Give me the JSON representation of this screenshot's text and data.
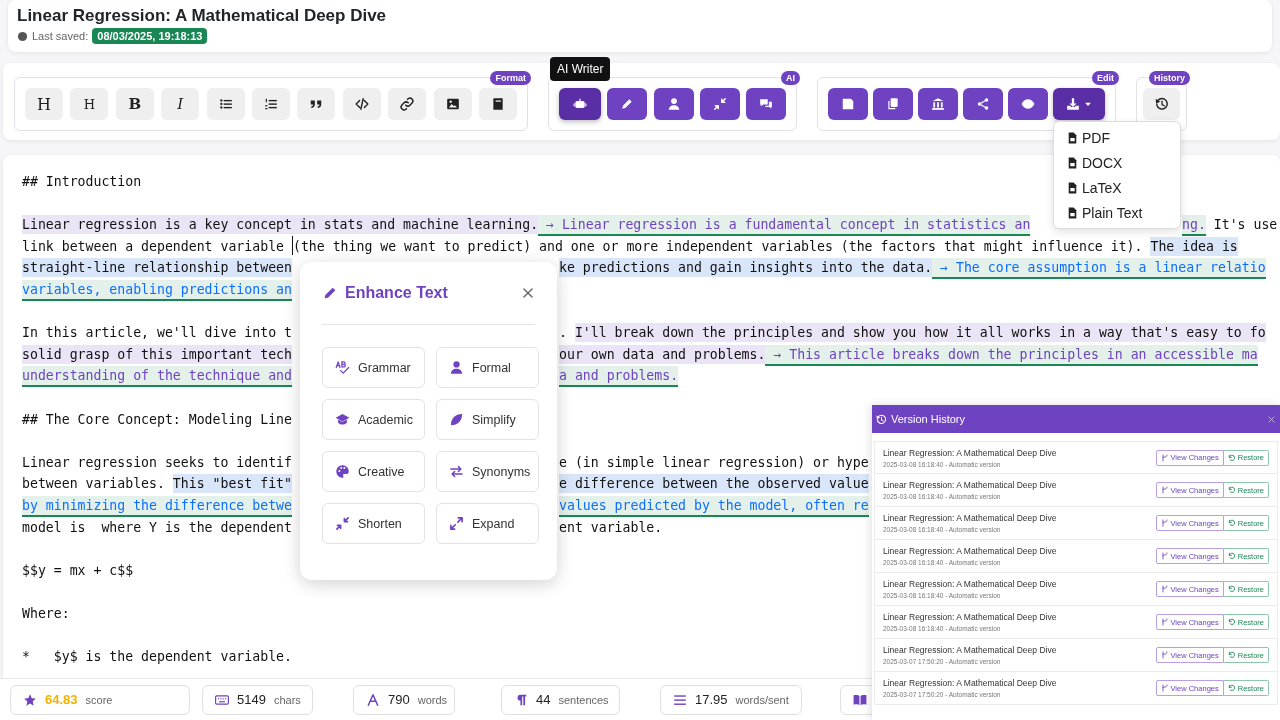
{
  "document": {
    "title": "Linear Regression: A Mathematical Deep Dive",
    "saved_label": "Last saved:",
    "saved_time": "08/03/2025, 19:18:13"
  },
  "toolbar": {
    "format": {
      "badge": "Format",
      "text_buttons": [
        "H",
        "H",
        "B",
        "I"
      ]
    },
    "ai": {
      "badge": "AI",
      "tooltip": "AI Writer",
      "buttons": [
        {
          "selected": true
        },
        {
          "selected": false
        },
        {
          "selected": false
        },
        {
          "selected": false
        },
        {
          "selected": false
        }
      ]
    },
    "edit": {
      "badge": "Edit",
      "download_menu": {
        "open": true,
        "items": [
          "PDF",
          "DOCX",
          "LaTeX",
          "Plain Text"
        ]
      }
    },
    "history": {
      "badge": "History"
    }
  },
  "editor": {
    "paragraphs": [
      {
        "lines": [
          {
            "segments": [
              {
                "kind": "plain",
                "text": "## Introduction"
              }
            ]
          }
        ]
      },
      {
        "lines": [
          {
            "segments": [
              {
                "kind": "original",
                "text": "Linear regression is a key concept in stats and machine learning."
              },
              {
                "kind": "rewrite",
                "text": " → Linear regression is a fundamental concept in statistics an"
              }
            ],
            "after_menu": [
              {
                "kind": "rewrite",
                "text": "ng."
              },
              {
                "kind": "plain",
                "text": " It's use"
              }
            ]
          },
          {
            "segments": [
              {
                "kind": "plain",
                "text": "link between a dependent variable "
              },
              {
                "kind": "plain",
                "cursor": true,
                "text": "(the thing we want to predict) and one or more independent variables (the factors that might influence it). "
              },
              {
                "kind": "selected",
                "text": "The idea is"
              }
            ]
          },
          {
            "segments": [
              {
                "kind": "selected",
                "text": "straight-line relationship between"
              }
            ],
            "after_popup": [
              {
                "kind": "selected",
                "text": "ke predictions and gain insights into the data."
              },
              {
                "kind": "selected-rewrite",
                "text": " → The core assumption is a linear relatio"
              }
            ]
          },
          {
            "segments": [
              {
                "kind": "selected-rewrite",
                "text": "variables, enabling predictions an"
              }
            ]
          }
        ]
      },
      {
        "lines": [
          {
            "segments": [
              {
                "kind": "plain",
                "text": "In this article, we'll dive into t"
              }
            ],
            "after_popup": [
              {
                "kind": "plain",
                "text": ". "
              },
              {
                "kind": "original",
                "text": "I'll break down the principles and show you how it all works in a way that's easy to fo"
              }
            ]
          },
          {
            "segments": [
              {
                "kind": "original",
                "text": "solid grasp of this important tech"
              }
            ],
            "after_popup": [
              {
                "kind": "original",
                "text": "our own data and problems."
              },
              {
                "kind": "rewrite",
                "text": " → This article breaks down the principles in an accessible ma"
              }
            ]
          },
          {
            "segments": [
              {
                "kind": "rewrite",
                "text": "understanding of the technique and"
              }
            ],
            "after_popup": [
              {
                "kind": "rewrite",
                "text": "a and problems."
              }
            ]
          }
        ]
      },
      {
        "lines": [
          {
            "segments": [
              {
                "kind": "plain",
                "text": "## The Core Concept: Modeling Line"
              }
            ]
          }
        ]
      },
      {
        "lines": [
          {
            "segments": [
              {
                "kind": "plain",
                "text": "Linear regression seeks to identif"
              }
            ],
            "after_popup": [
              {
                "kind": "plain",
                "text": "e (in simple linear regression) or hype"
              }
            ]
          },
          {
            "segments": [
              {
                "kind": "plain",
                "text": "between variables. "
              },
              {
                "kind": "selected",
                "text": "This \"best fit\""
              }
            ],
            "after_popup": [
              {
                "kind": "selected",
                "text": "e difference between the observed value"
              }
            ]
          },
          {
            "segments": [
              {
                "kind": "selected-rewrite",
                "text": "by minimizing the difference betwe"
              }
            ],
            "after_popup": [
              {
                "kind": "selected-rewrite",
                "text": "values predicted by the model, often re"
              }
            ]
          },
          {
            "segments": [
              {
                "kind": "plain",
                "text": "model is  where Y is the dependent"
              }
            ],
            "after_popup": [
              {
                "kind": "plain",
                "text": "ent variable."
              }
            ]
          }
        ]
      },
      {
        "lines": [
          {
            "segments": [
              {
                "kind": "plain",
                "text": "$$y = mx + c$$"
              }
            ]
          }
        ]
      },
      {
        "lines": [
          {
            "segments": [
              {
                "kind": "plain",
                "text": "Where:"
              }
            ]
          }
        ]
      },
      {
        "lines": [
          {
            "segments": [
              {
                "kind": "plain",
                "text": "*   $y$ is the dependent variable."
              }
            ]
          }
        ]
      }
    ]
  },
  "enhance": {
    "title": "Enhance Text",
    "options": [
      {
        "kind": "grammar",
        "label": "Grammar"
      },
      {
        "kind": "formal",
        "label": "Formal"
      },
      {
        "kind": "academic",
        "label": "Academic"
      },
      {
        "kind": "simplify",
        "label": "Simplify"
      },
      {
        "kind": "creative",
        "label": "Creative"
      },
      {
        "kind": "synonyms",
        "label": "Synonyms"
      },
      {
        "kind": "shorten",
        "label": "Shorten"
      },
      {
        "kind": "expand",
        "label": "Expand"
      }
    ]
  },
  "stats": [
    {
      "kind": "score",
      "value": "64.83",
      "unit": "score"
    },
    {
      "kind": "chars",
      "value": "5149",
      "unit": "chars"
    },
    {
      "kind": "words",
      "value": "790",
      "unit": "words"
    },
    {
      "kind": "sentences",
      "value": "44",
      "unit": "sentences"
    },
    {
      "kind": "average",
      "value": "17.95",
      "unit": "words/sent"
    },
    {
      "kind": "reading"
    }
  ],
  "version_history": {
    "title": "Version History",
    "versions": [
      {
        "title": "Linear Regression: A Mathematical Deep Dive",
        "meta": "2025-03-08 16:18:40 - Automatic version",
        "view": "View Changes",
        "restore": "Restore"
      },
      {
        "title": "Linear Regression: A Mathematical Deep Dive",
        "meta": "2025-03-08 16:18:40 - Automatic version",
        "view": "View Changes",
        "restore": "Restore"
      },
      {
        "title": "Linear Regression: A Mathematical Deep Dive",
        "meta": "2025-03-08 16:18:40 - Automatic version",
        "view": "View Changes",
        "restore": "Restore"
      },
      {
        "title": "Linear Regression: A Mathematical Deep Dive",
        "meta": "2025-03-08 16:18:40 - Automatic version",
        "view": "View Changes",
        "restore": "Restore"
      },
      {
        "title": "Linear Regression: A Mathematical Deep Dive",
        "meta": "2025-03-08 16:18:40 - Automatic version",
        "view": "View Changes",
        "restore": "Restore"
      },
      {
        "title": "Linear Regression: A Mathematical Deep Dive",
        "meta": "2025-03-08 16:18:40 - Automatic version",
        "view": "View Changes",
        "restore": "Restore"
      },
      {
        "title": "Linear Regression: A Mathematical Deep Dive",
        "meta": "2025-03-07 17:50:20 - Automatic version",
        "view": "View Changes",
        "restore": "Restore"
      },
      {
        "title": "Linear Regression: A Mathematical Deep Dive",
        "meta": "2025-03-07 17:50:20 - Automatic version",
        "view": "View Changes",
        "restore": "Restore"
      }
    ]
  }
}
